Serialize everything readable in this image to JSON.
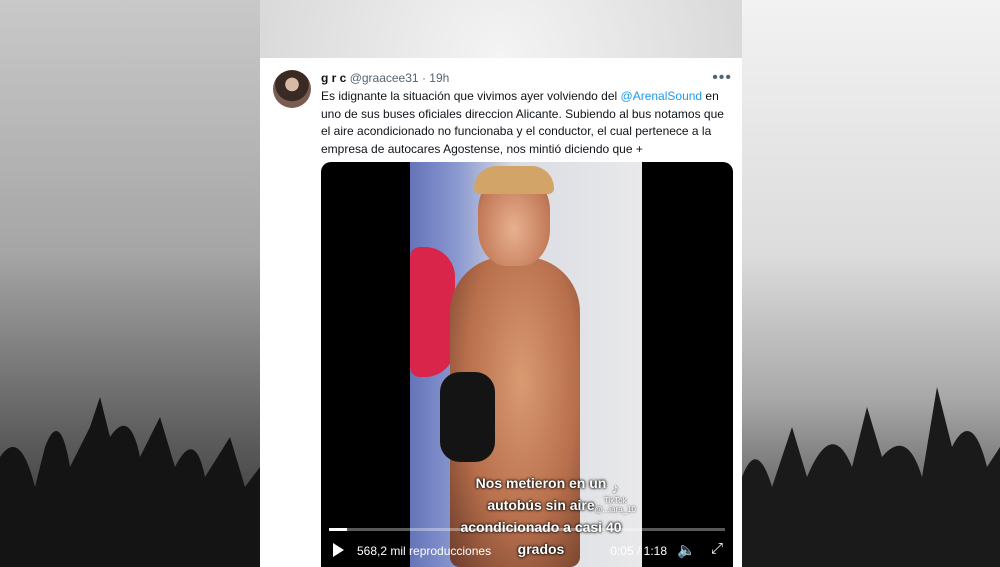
{
  "tweet": {
    "display_name": "g r c",
    "handle": "@graacee31",
    "separator": "·",
    "time": "19h",
    "more_icon": "more-dots-icon",
    "text_part1": "Es idignante la situación que vivimos ayer volviendo del ",
    "mention": "@ArenalSound",
    "text_part2": " en uno de sus buses oficiales direccion Alicante. Subiendo al bus notamos que el aire acondicionado no funcionaba y el conductor, el cual pertenece a la empresa de autocares Agostense, nos mintió diciendo que +",
    "mention_color": "#1d9bf0"
  },
  "video": {
    "caption_lines": [
      "Nos metieron en un",
      "autobús sin aire",
      "acondicionado a casi 40",
      "grados"
    ],
    "watermark": "TikTok",
    "watermark_user": "@...iara_10",
    "progress": 0.046,
    "views": "568,2 mil reproducciones",
    "current_time": "0:05",
    "time_separator": " / ",
    "duration": "1:18",
    "icons": [
      "play-icon",
      "volume-icon",
      "fullscreen-icon"
    ]
  }
}
